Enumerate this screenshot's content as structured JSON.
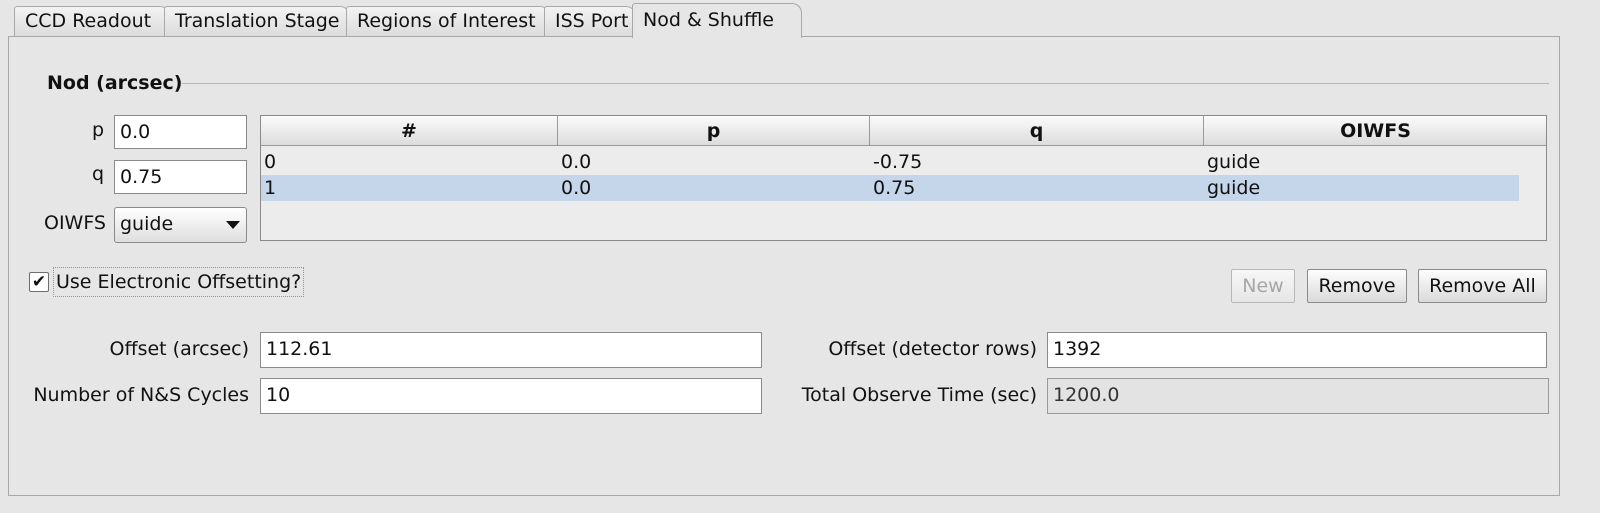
{
  "tabs": [
    {
      "label": "CCD Readout"
    },
    {
      "label": "Translation Stage"
    },
    {
      "label": "Regions of Interest"
    },
    {
      "label": "ISS Port"
    },
    {
      "label": "Nod & Shuffle",
      "active": true
    }
  ],
  "nod": {
    "section_title": "Nod (arcsec)",
    "p_label": "p",
    "p_value": "0.0",
    "q_label": "q",
    "q_value": "0.75",
    "oiwfs_label": "OIWFS",
    "oiwfs_value": "guide"
  },
  "table": {
    "columns": [
      "#",
      "p",
      "q",
      "OIWFS"
    ],
    "rows": [
      {
        "index": "0",
        "p": "0.0",
        "q": "-0.75",
        "oiwfs": "guide",
        "selected": false
      },
      {
        "index": "1",
        "p": "0.0",
        "q": "0.75",
        "oiwfs": "guide",
        "selected": true
      }
    ]
  },
  "electronic_offsetting": {
    "label": "Use Electronic Offsetting?",
    "checked": true
  },
  "buttons": {
    "new_label": "New",
    "remove_label": "Remove",
    "remove_all_label": "Remove All"
  },
  "offsets": {
    "offset_arcsec_label": "Offset (arcsec)",
    "offset_arcsec_value": "112.61",
    "offset_rows_label": "Offset (detector rows)",
    "offset_rows_value": "1392",
    "cycles_label": "Number of N&S Cycles",
    "cycles_value": "10",
    "total_time_label": "Total Observe Time (sec)",
    "total_time_value": "1200.0"
  },
  "icons": {
    "dropdown": "chevron-down-icon",
    "checkmark": "checkmark-icon"
  }
}
